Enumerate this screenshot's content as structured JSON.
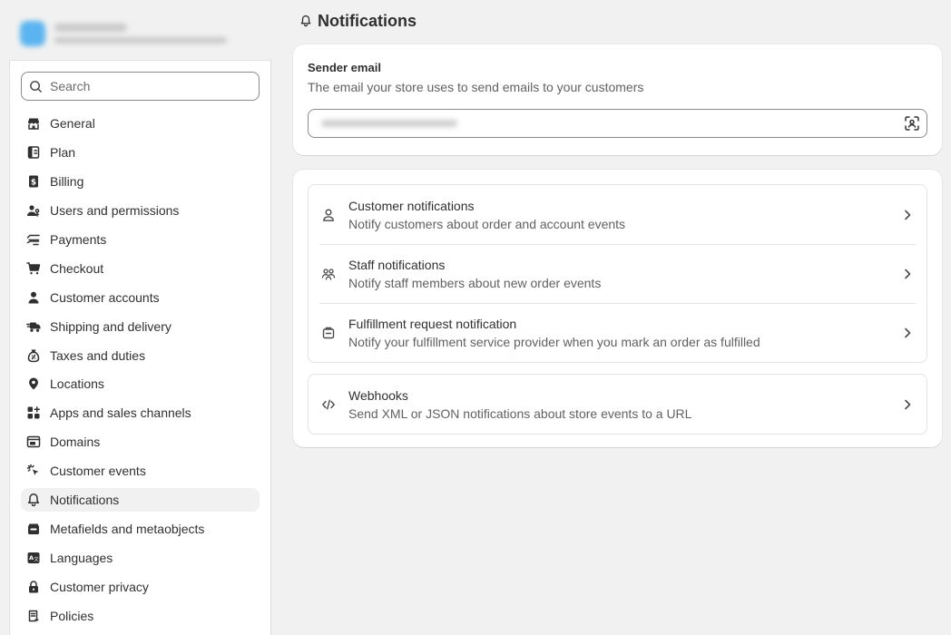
{
  "page": {
    "title": "Notifications"
  },
  "sidebar": {
    "search_placeholder": "Search",
    "items": [
      {
        "label": "General",
        "icon": "store-icon"
      },
      {
        "label": "Plan",
        "icon": "plan-icon"
      },
      {
        "label": "Billing",
        "icon": "billing-icon"
      },
      {
        "label": "Users and permissions",
        "icon": "users-icon"
      },
      {
        "label": "Payments",
        "icon": "payments-icon"
      },
      {
        "label": "Checkout",
        "icon": "cart-icon"
      },
      {
        "label": "Customer accounts",
        "icon": "person-icon"
      },
      {
        "label": "Shipping and delivery",
        "icon": "truck-icon"
      },
      {
        "label": "Taxes and duties",
        "icon": "tax-icon"
      },
      {
        "label": "Locations",
        "icon": "location-icon"
      },
      {
        "label": "Apps and sales channels",
        "icon": "apps-icon"
      },
      {
        "label": "Domains",
        "icon": "domains-icon"
      },
      {
        "label": "Customer events",
        "icon": "cursor-click-icon"
      },
      {
        "label": "Notifications",
        "icon": "bell-icon",
        "active": true
      },
      {
        "label": "Metafields and metaobjects",
        "icon": "metafields-icon"
      },
      {
        "label": "Languages",
        "icon": "language-icon"
      },
      {
        "label": "Customer privacy",
        "icon": "lock-icon"
      },
      {
        "label": "Policies",
        "icon": "policies-icon"
      }
    ]
  },
  "sender": {
    "title": "Sender email",
    "description": "The email your store uses to send emails to your customers"
  },
  "notifications": [
    {
      "title": "Customer notifications",
      "subtitle": "Notify customers about order and account events",
      "icon": "person-icon"
    },
    {
      "title": "Staff notifications",
      "subtitle": "Notify staff members about new order events",
      "icon": "team-icon"
    },
    {
      "title": "Fulfillment request notification",
      "subtitle": "Notify your fulfillment service provider when you mark an order as fulfilled",
      "icon": "package-icon"
    }
  ],
  "webhooks": {
    "title": "Webhooks",
    "subtitle": "Send XML or JSON notifications about store events to a URL",
    "icon": "code-icon"
  },
  "colors": {
    "background": "#f1f1f1",
    "card": "#ffffff",
    "text": "#303030",
    "muted": "#616161",
    "active_item": "#f1f1f1"
  }
}
